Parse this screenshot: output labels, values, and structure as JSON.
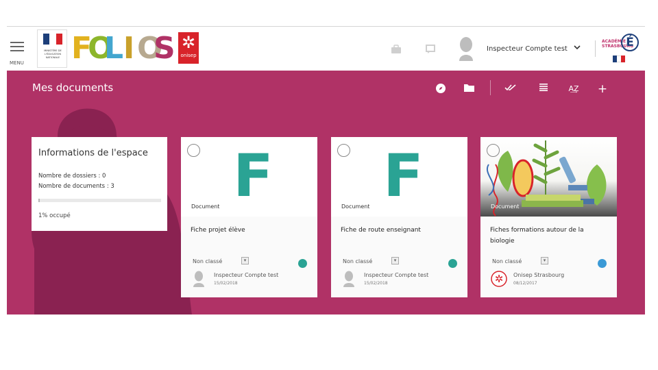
{
  "header": {
    "menu_label": "MENU",
    "marianne_text": "MINISTÈRE DE L'ÉDUCATION NATIONALE",
    "brand_letters": [
      {
        "ch": "F",
        "color": "#e2b21f"
      },
      {
        "ch": "O",
        "color": "#8db62b"
      },
      {
        "ch": "L",
        "color": "#43a6cf"
      },
      {
        "ch": "I",
        "color": "#c9a12b"
      },
      {
        "ch": "O",
        "color": "#b7a990"
      },
      {
        "ch": "S",
        "color": "#b03266"
      }
    ],
    "onisep_label": "onisep",
    "icons": {
      "briefcase": "briefcase-icon",
      "chat": "chat-icon"
    },
    "user_name": "Inspecteur Compte test",
    "academie_text": "ACADÉMIE STRASBOURG",
    "academie_letter": "É"
  },
  "toolbar": {
    "title": "Mes documents",
    "icons": [
      "compass-icon",
      "folder-icon",
      "check-all-icon",
      "list-icon",
      "sort-az-icon",
      "plus-icon"
    ]
  },
  "info_panel": {
    "title": "Informations de l'espace",
    "folders_line": "Nombre de dossiers : 0",
    "documents_line": "Nombre de documents : 3",
    "used_fraction": 0.01,
    "used_text": "1% occupé"
  },
  "cards": [
    {
      "type": "Document",
      "letter": "F",
      "title": "Fiche projet élève",
      "classification": "Non classé",
      "status_color": "#2aa394",
      "author": "Inspecteur Compte test",
      "date": "15/02/2018"
    },
    {
      "type": "Document",
      "letter": "F",
      "title": "Fiche de route enseignant",
      "classification": "Non classé",
      "status_color": "#2aa394",
      "author": "Inspecteur Compte test",
      "date": "15/02/2018"
    },
    {
      "type": "Document",
      "letter": "",
      "title": "Fiches formations autour de la biologie",
      "classification": "Non classé",
      "status_color": "#3b9ad6",
      "author": "Onisep Strasbourg",
      "date": "08/12/2017"
    }
  ],
  "colors": {
    "band": "#b03266",
    "accent_teal": "#2aa394",
    "accent_blue": "#3b9ad6"
  }
}
